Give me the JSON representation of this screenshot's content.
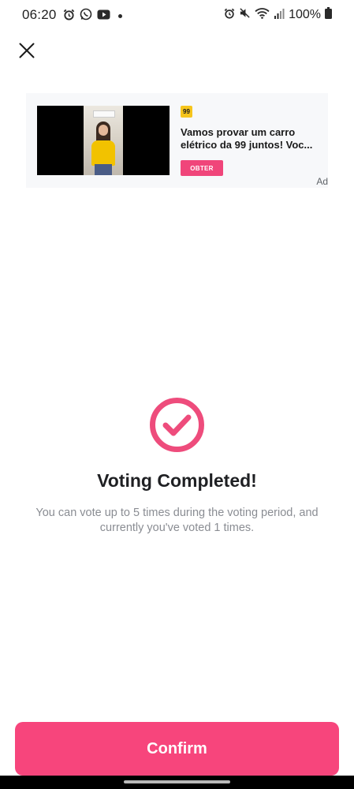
{
  "status_bar": {
    "time": "06:20",
    "battery": "100%",
    "left_icons": [
      "alarm-icon",
      "whatsapp-icon",
      "youtube-icon",
      "notification-dot-icon"
    ],
    "right_icons": [
      "alarm-icon",
      "mute-icon",
      "wifi-icon",
      "signal-icon",
      "battery-icon"
    ]
  },
  "ad": {
    "logo_text": "99",
    "headline": "Vamos provar um carro elétrico da 99 juntos! Voc...",
    "cta": "OBTER",
    "label": "Ad"
  },
  "result": {
    "title": "Voting Completed!",
    "description": "You can vote up to 5 times during the voting period, and currently you've voted 1 times."
  },
  "confirm_label": "Confirm",
  "colors": {
    "accent": "#f7457c",
    "check_ring": "#ee4c7c",
    "ad_cta": "#f0457a",
    "muted_text": "#8a8d93"
  }
}
